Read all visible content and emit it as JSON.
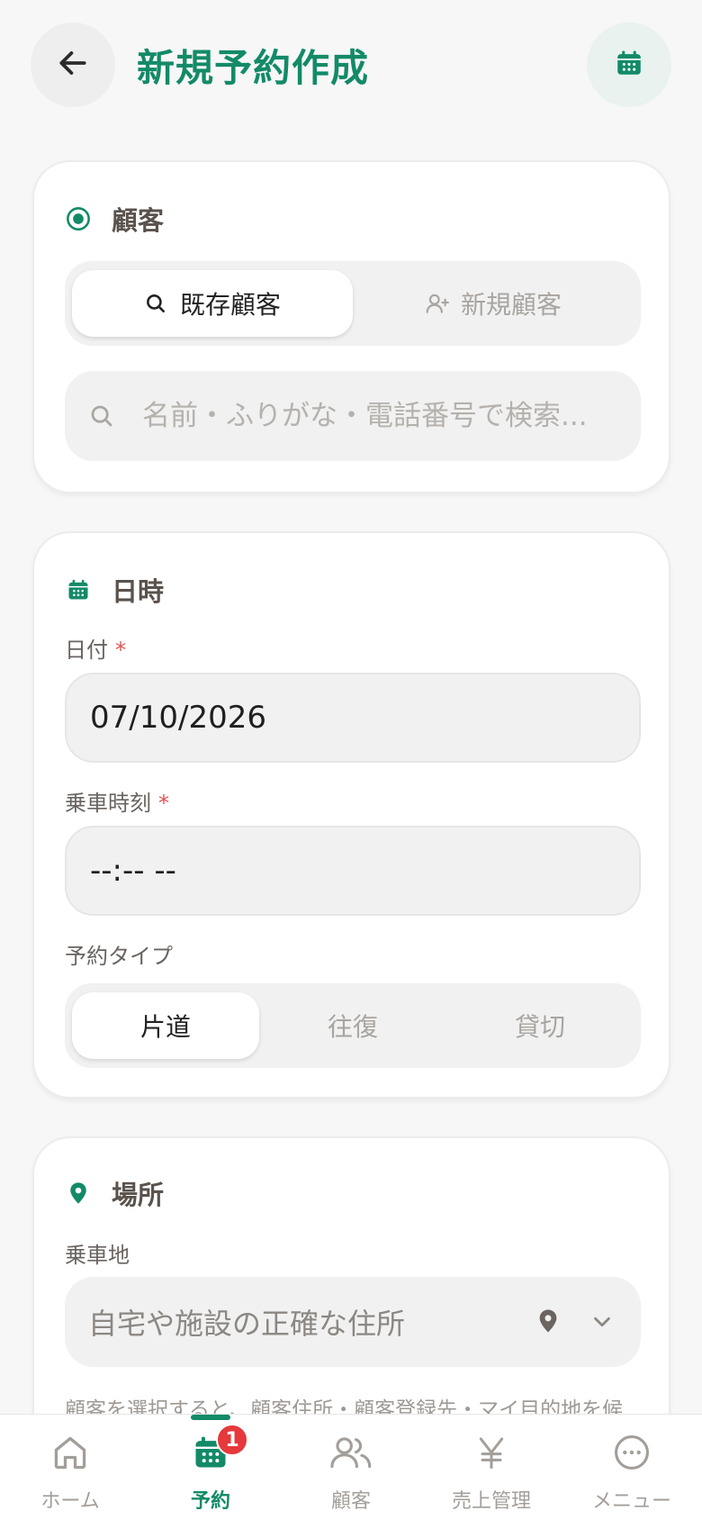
{
  "header": {
    "title": "新規予約作成"
  },
  "customer": {
    "title": "顧客",
    "existing_tab": "既存顧客",
    "new_tab": "新規顧客",
    "search_placeholder": "名前・ふりがな・電話番号で検索..."
  },
  "datetime": {
    "title": "日時",
    "date_label": "日付",
    "date_value": "07/10/2026",
    "time_label": "乗車時刻",
    "time_value": "--:-- --",
    "type_label": "予約タイプ",
    "required_mark": "*",
    "types": [
      "片道",
      "往復",
      "貸切"
    ],
    "selected_type": "片道"
  },
  "location": {
    "title": "場所",
    "pickup_label": "乗車地",
    "pickup_placeholder": "自宅や施設の正確な住所",
    "helper": "顧客を選択すると、顧客住所・顧客登録先・マイ目的地を候"
  },
  "nav": {
    "items": [
      {
        "label": "ホーム",
        "icon": "home-icon"
      },
      {
        "label": "予約",
        "icon": "calendar-icon"
      },
      {
        "label": "顧客",
        "icon": "users-icon"
      },
      {
        "label": "売上管理",
        "icon": "yen-icon"
      },
      {
        "label": "メニュー",
        "icon": "more-icon"
      }
    ],
    "active": "予約",
    "badge": "1"
  },
  "colors": {
    "accent": "#138a68",
    "badge": "#e5393b"
  }
}
